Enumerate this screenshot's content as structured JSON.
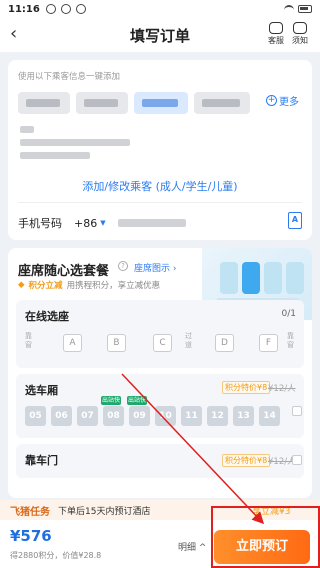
{
  "status_bar": {
    "time": "11:16"
  },
  "nav": {
    "title": "填写订单",
    "kefu": "客服",
    "xuzhi": "须知"
  },
  "passenger": {
    "hint": "使用以下乘客信息一键添加",
    "more_label": "更多",
    "add_link": "添加/修改乘客 (成人/学生/儿童)",
    "phone_label": "手机号码",
    "country_code": "+86",
    "contact_icon": "contact-book-icon"
  },
  "seat_section": {
    "title": "座席随心选套餐",
    "map_link": "座席图示 ›",
    "points_badge": "积分立减",
    "points_desc": "用携程积分，享立减优惠",
    "online": {
      "title": "在线选座",
      "count": "0/1",
      "window_left": "靠窗",
      "aisle": "过道",
      "window_right": "靠窗",
      "seats": [
        "A",
        "B",
        "C",
        "D",
        "F"
      ]
    },
    "car": {
      "title": "选车厢",
      "points_price": "积分特价¥8",
      "orig_price": "¥12/人",
      "cars": [
        "05",
        "06",
        "07",
        "08",
        "09",
        "10",
        "11",
        "12",
        "13",
        "14"
      ],
      "tag_label": "出站快"
    },
    "door": {
      "title": "靠车门",
      "points_price": "积分特价¥8",
      "orig_price": "¥12/人"
    }
  },
  "banner": {
    "tag": "飞猪任务",
    "text": "下单后15天内预订酒店",
    "promo": "享立减¥3"
  },
  "bottom": {
    "price": "¥576",
    "sub": "得2880积分，价值¥28.8",
    "detail": "明细 ^",
    "book": "立即预订"
  },
  "colors": {
    "accent": "#2c7cf0",
    "book": "#ff7a1f",
    "annotation": "#e02020"
  }
}
